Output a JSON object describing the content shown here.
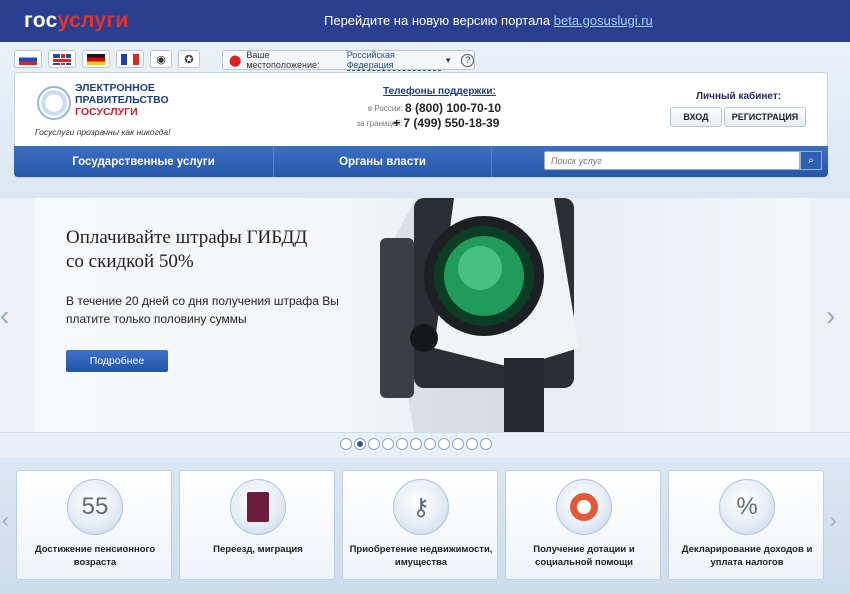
{
  "topbar": {
    "brand_part1": "гос",
    "brand_part2": "услуги",
    "message": "Перейдите на новую версию портала",
    "link": "beta.gosuslugi.ru"
  },
  "location": {
    "label": "Ваше местоположение:",
    "value": "Российская Федерация",
    "help": "?"
  },
  "logo": {
    "line1": "ЭЛЕКТРОННОЕ",
    "line2": "ПРАВИТЕЛЬСТВО",
    "line3": "ГОСУСЛУГИ",
    "slogan": "Госуслуги прозрачны как никогда!"
  },
  "phones": {
    "title": "Телефоны поддержки:",
    "russia_label": "в России:",
    "russia_number": "8 (800) 100-70-10",
    "abroad_label": "за границей:",
    "abroad_number": "+ 7 (499) 550-18-39"
  },
  "cabinet": {
    "title": "Личный кабинет:",
    "login": "ВХОД",
    "register": "РЕГИСТРАЦИЯ"
  },
  "nav": {
    "item1": "Государственные услуги",
    "item2": "Органы власти",
    "search_placeholder": "Поиск услуг"
  },
  "banner": {
    "title": "Оплачивайте штрафы ГИБДД со скидкой 50%",
    "text": "В течение 20 дней со дня получения штрафа Вы платите только половину суммы",
    "button": "Подробнее"
  },
  "slider": {
    "total": 11,
    "active_index": 1
  },
  "services": [
    {
      "label": "Достижение пенсионного возраста",
      "icon": "calendar-icon",
      "icon_text": "55"
    },
    {
      "label": "Переезд, миграция",
      "icon": "passport-icon"
    },
    {
      "label": "Приобретение недвижимости, имущества",
      "icon": "keys-icon"
    },
    {
      "label": "Получение дотации и социальной помощи",
      "icon": "lifebuoy-icon"
    },
    {
      "label": "Декларирование доходов и уплата налогов",
      "icon": "percent-icon",
      "icon_text": "%"
    }
  ],
  "colors": {
    "topbar": "#2a3f8f",
    "accent_blue": "#2657a8",
    "brand_red": "#e4342d"
  }
}
